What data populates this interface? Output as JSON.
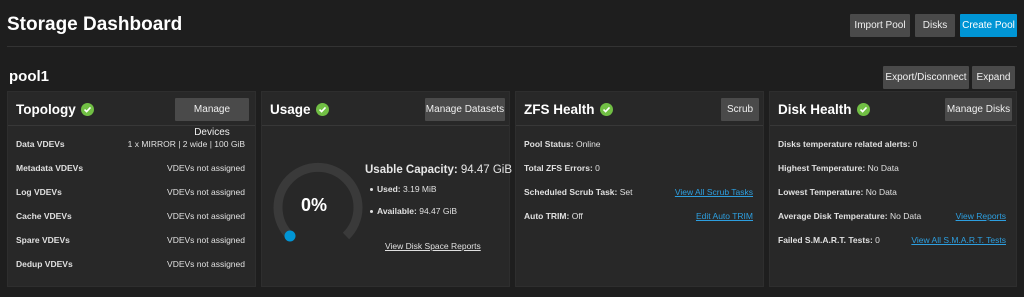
{
  "header": {
    "title": "Storage Dashboard",
    "import_pool": "Import Pool",
    "disks": "Disks",
    "create_pool": "Create Pool"
  },
  "pool": {
    "name": "pool1",
    "export_disconnect": "Export/Disconnect",
    "expand": "Expand"
  },
  "topology": {
    "title": "Topology",
    "button": "Manage Devices",
    "rows": [
      {
        "label": "Data VDEVs",
        "value": "1 x MIRROR | 2 wide | 100 GiB"
      },
      {
        "label": "Metadata VDEVs",
        "value": "VDEVs not assigned"
      },
      {
        "label": "Log VDEVs",
        "value": "VDEVs not assigned"
      },
      {
        "label": "Cache VDEVs",
        "value": "VDEVs not assigned"
      },
      {
        "label": "Spare VDEVs",
        "value": "VDEVs not assigned"
      },
      {
        "label": "Dedup VDEVs",
        "value": "VDEVs not assigned"
      }
    ]
  },
  "usage": {
    "title": "Usage",
    "button": "Manage Datasets",
    "percent_label": "0%",
    "percent_value": 0,
    "capacity_label": "Usable Capacity:",
    "capacity_value": "94.47 GiB",
    "used_label": "Used:",
    "used_value": "3.19 MiB",
    "available_label": "Available:",
    "available_value": "94.47 GiB",
    "link": "View Disk Space Reports"
  },
  "zfs": {
    "title": "ZFS Health",
    "button": "Scrub",
    "pool_status_label": "Pool Status:",
    "pool_status_value": "Online",
    "errors_label": "Total ZFS Errors:",
    "errors_value": "0",
    "scrub_label": "Scheduled Scrub Task:",
    "scrub_value": "Set",
    "scrub_link": "View All Scrub Tasks",
    "trim_label": "Auto TRIM:",
    "trim_value": "Off",
    "trim_link": "Edit Auto TRIM"
  },
  "disk_health": {
    "title": "Disk Health",
    "button": "Manage Disks",
    "alerts_label": "Disks temperature related alerts:",
    "alerts_value": "0",
    "highest_label": "Highest Temperature:",
    "highest_value": "No Data",
    "lowest_label": "Lowest Temperature:",
    "lowest_value": "No Data",
    "avg_label": "Average Disk Temperature:",
    "avg_value": "No Data",
    "avg_link": "View Reports",
    "smart_label": "Failed S.M.A.R.T. Tests:",
    "smart_value": "0",
    "smart_link": "View All S.M.A.R.T. Tests"
  },
  "colors": {
    "accent": "#0095d5",
    "healthy": "#71bf44",
    "link": "#2d9fe0"
  }
}
